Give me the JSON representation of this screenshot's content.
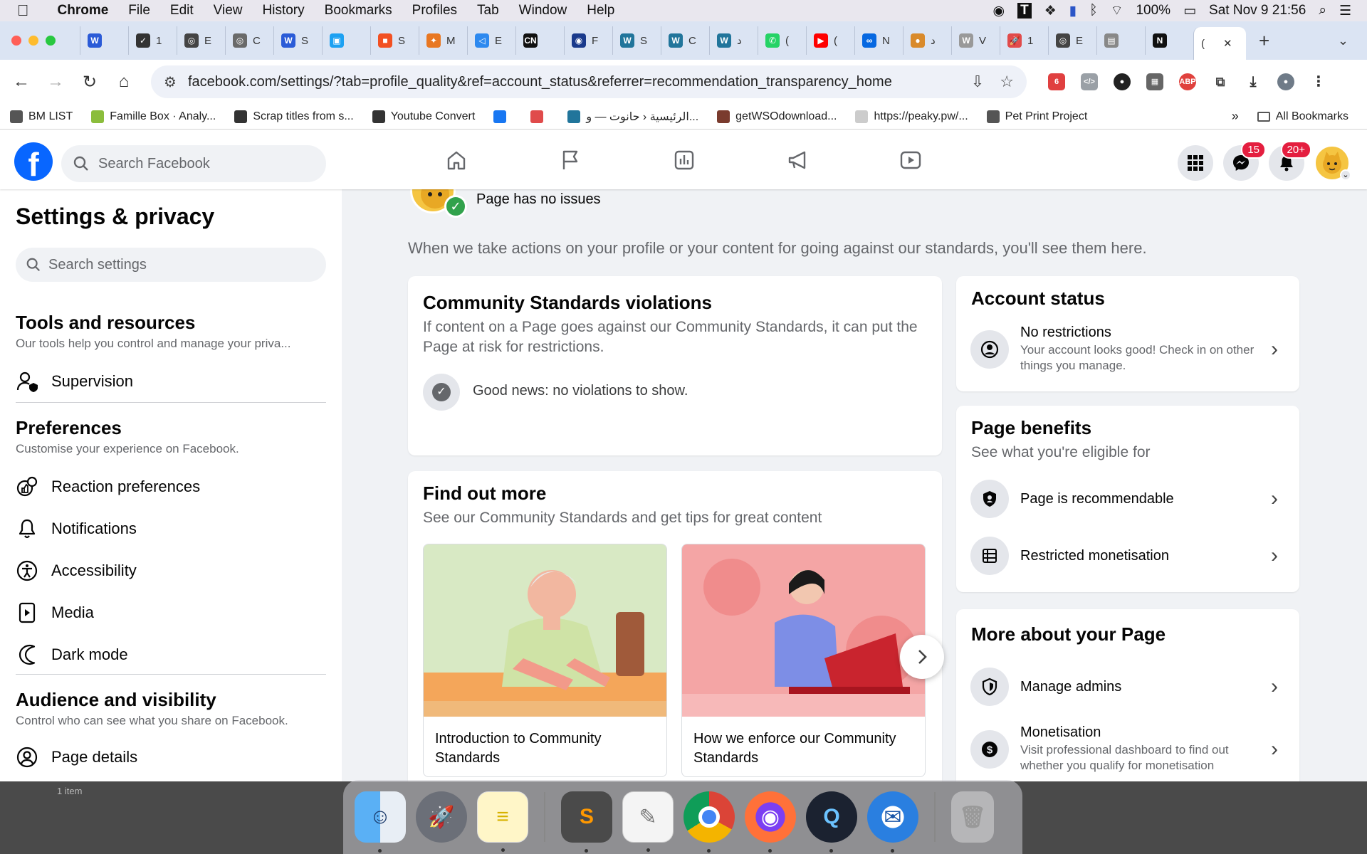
{
  "menubar": {
    "app_name": "Chrome",
    "items": [
      "File",
      "Edit",
      "View",
      "History",
      "Bookmarks",
      "Profiles",
      "Tab",
      "Window",
      "Help"
    ],
    "battery": "100%",
    "datetime": "Sat Nov 9  21:56"
  },
  "tabs": [
    {
      "label": "",
      "color": "#2b5bd7",
      "glyph": "W"
    },
    {
      "label": "1",
      "color": "#333333",
      "glyph": "✓"
    },
    {
      "label": "E",
      "color": "#444444",
      "glyph": "◎"
    },
    {
      "label": "C",
      "color": "#6a6a6a",
      "glyph": "◎"
    },
    {
      "label": "S",
      "color": "#2b5bd7",
      "glyph": "W"
    },
    {
      "label": "",
      "color": "#1da1f2",
      "glyph": "▣"
    },
    {
      "label": "S",
      "color": "#f25022",
      "glyph": "■"
    },
    {
      "label": "M",
      "color": "#e87722",
      "glyph": "✦"
    },
    {
      "label": "E",
      "color": "#2d89ef",
      "glyph": "◁"
    },
    {
      "label": "",
      "color": "#111111",
      "glyph": "CN"
    },
    {
      "label": "F",
      "color": "#1a3a8c",
      "glyph": "◉"
    },
    {
      "label": "S",
      "color": "#21759b",
      "glyph": "W"
    },
    {
      "label": "C",
      "color": "#21759b",
      "glyph": "W"
    },
    {
      "label": "د",
      "color": "#21759b",
      "glyph": "W"
    },
    {
      "label": "(",
      "color": "#25d366",
      "glyph": "✆"
    },
    {
      "label": "(",
      "color": "#ff0000",
      "glyph": "▶"
    },
    {
      "label": "N",
      "color": "#0668e1",
      "glyph": "∞"
    },
    {
      "label": "د",
      "color": "#d98a2b",
      "glyph": "●"
    },
    {
      "label": "V",
      "color": "#999999",
      "glyph": "W"
    },
    {
      "label": "1",
      "color": "#e14b4b",
      "glyph": "🚀"
    },
    {
      "label": "E",
      "color": "#444444",
      "glyph": "◎"
    },
    {
      "label": "",
      "color": "#888888",
      "glyph": "▤"
    },
    {
      "label": "",
      "color": "#111111",
      "glyph": "N"
    },
    {
      "label": "(",
      "color": "#ffffff",
      "glyph": ""
    }
  ],
  "address": {
    "url": "facebook.com/settings/?tab=profile_quality&ref=account_status&referrer=recommendation_transparency_home"
  },
  "bookmarks": {
    "items": [
      {
        "label": "BM LIST",
        "color": "#555555"
      },
      {
        "label": "Famille Box · Analy...",
        "color": "#8bbd3c"
      },
      {
        "label": "Scrap titles from s...",
        "color": "#333333"
      },
      {
        "label": "Youtube Convert",
        "color": "#333333"
      },
      {
        "label": "",
        "color": "#1877f2"
      },
      {
        "label": "",
        "color": "#e04b4b"
      },
      {
        "label": "الرئيسية ‹ حانوت — و...",
        "color": "#21759b"
      },
      {
        "label": "getWSOdownload...",
        "color": "#7a3b2e"
      },
      {
        "label": "https://peaky.pw/...",
        "color": "#cccccc"
      },
      {
        "label": "Pet Print Project",
        "color": "#555555"
      }
    ],
    "all_label": "All Bookmarks"
  },
  "fb": {
    "logo": "f",
    "search_placeholder": "Search Facebook",
    "messenger_badge": "15",
    "notifications_badge": "20+"
  },
  "sidebar": {
    "title": "Settings & privacy",
    "search_placeholder": "Search settings",
    "tools": {
      "title": "Tools and resources",
      "desc": "Our tools help you control and manage your priva...",
      "items": [
        "Supervision"
      ]
    },
    "preferences": {
      "title": "Preferences",
      "desc": "Customise your experience on Facebook.",
      "items": [
        "Reaction preferences",
        "Notifications",
        "Accessibility",
        "Media",
        "Dark mode"
      ]
    },
    "audience": {
      "title": "Audience and visibility",
      "desc": "Control who can see what you share on Facebook.",
      "items": [
        "Page details"
      ]
    }
  },
  "main": {
    "page_status": "Page has no issues",
    "intro": "When we take actions on your profile or your content for going against our standards, you'll see them here.",
    "violations": {
      "title": "Community Standards violations",
      "desc": "If content on a Page goes against our Community Standards, it can put the Page at risk for restrictions.",
      "empty": "Good news: no violations to show."
    },
    "find_more": {
      "title": "Find out more",
      "desc": "See our Community Standards and get tips for great content",
      "cards": [
        "Introduction to Community Standards",
        "How we enforce our Community Standards"
      ]
    },
    "account_status": {
      "title": "Account status",
      "item_title": "No restrictions",
      "item_desc": "Your account looks good! Check in on other things you manage."
    },
    "benefits": {
      "title": "Page benefits",
      "desc": "See what you're eligible for",
      "items": [
        "Page is recommendable",
        "Restricted monetisation"
      ]
    },
    "more": {
      "title": "More about your Page",
      "items": [
        {
          "title": "Manage admins",
          "desc": ""
        },
        {
          "title": "Monetisation",
          "desc": "Visit professional dashboard to find out whether you qualify for monetisation"
        }
      ]
    }
  },
  "desktop": {
    "item_count": "1 item"
  },
  "colors": {
    "fb_blue": "#0866ff",
    "badge_red": "#e41e3f",
    "success_green": "#31a24c"
  }
}
